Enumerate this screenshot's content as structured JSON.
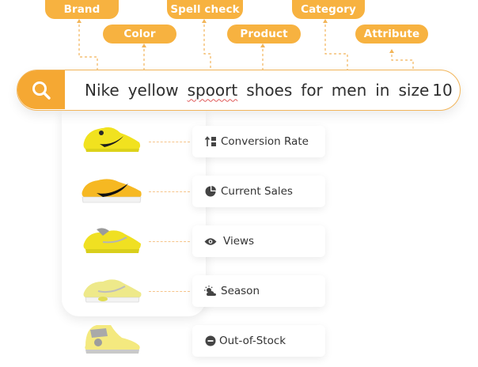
{
  "tags": {
    "brand": "Brand",
    "color": "Color",
    "spell_check": "Spell check",
    "product": "Product",
    "category": "Category",
    "attribute": "Attribute"
  },
  "search": {
    "words": [
      "Nike",
      "yellow",
      "spoort",
      "shoes",
      "for",
      "men",
      "in",
      "size",
      "10"
    ]
  },
  "metrics": [
    {
      "label": "Conversion Rate",
      "icon": "bar-sort-icon"
    },
    {
      "label": "Current Sales",
      "icon": "pie-chart-icon"
    },
    {
      "label": "Views",
      "icon": "eye-icon"
    },
    {
      "label": "Season",
      "icon": "sun-cloud-icon"
    },
    {
      "label": "Out-of-Stock",
      "icon": "minus-circle-icon"
    }
  ],
  "colors": {
    "accent": "#f7b240",
    "search_button": "#f5a833",
    "connector": "#f2b55a"
  }
}
